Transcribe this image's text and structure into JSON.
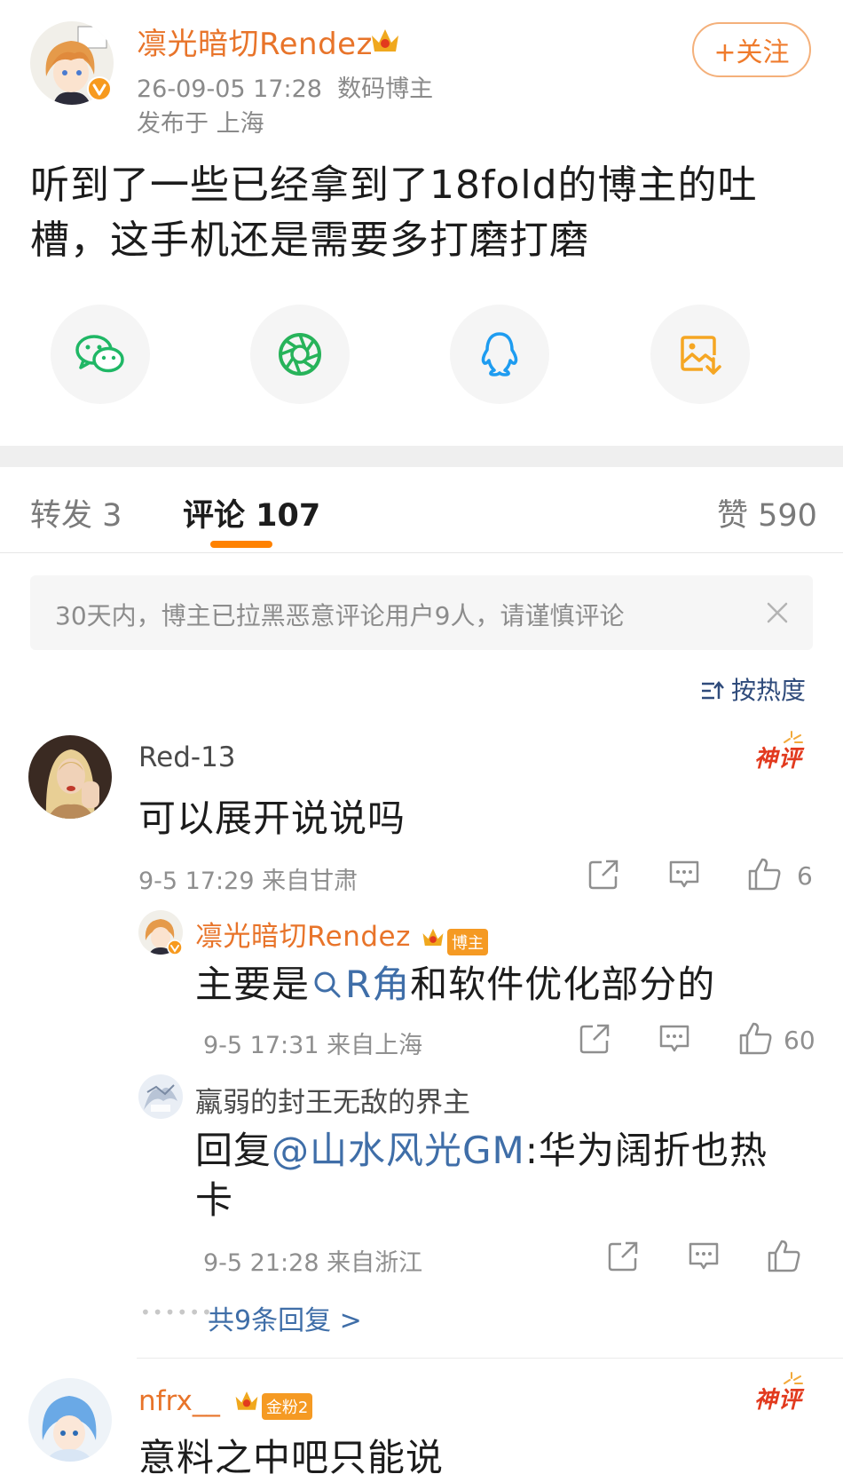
{
  "post": {
    "author": "凛光暗切Rendez",
    "time": "26-09-05 17:28",
    "role": "数码博主",
    "location": "发布于 上海",
    "follow_label": "+关注",
    "text_line1": "听到了一些已经拿到了18fold的博主的吐",
    "text_line2": "槽，这手机还是需要多打磨打磨"
  },
  "share": [
    {
      "icon": "wechat-icon",
      "color": "#1fb765"
    },
    {
      "icon": "moments-icon",
      "color": "#27b35a"
    },
    {
      "icon": "qq-icon",
      "color": "#1e9cf0"
    },
    {
      "icon": "save-image-icon",
      "color": "#f5a623"
    }
  ],
  "tabs": {
    "repost": "转发 3",
    "comments": "评论 107",
    "likes": "赞 590"
  },
  "notice": {
    "text": "30天内，博主已拉黑恶意评论用户9人，请谨慎评论"
  },
  "sort_label": "按热度",
  "comments": [
    {
      "user": "Red-13",
      "badge": "神评",
      "text": "可以展开说说吗",
      "meta": "9-5 17:29 来自甘肃",
      "likes": "6",
      "replies": [
        {
          "user": "凛光暗切Rendez",
          "tag": "博主",
          "text_a": "主要是",
          "text_link": "R角",
          "text_b": "和软件优化部分的",
          "meta": "9-5 17:31 来自上海",
          "likes": "60"
        },
        {
          "user": "羸弱的封王无敌的界主",
          "text_a": "回复",
          "text_link": "@山水风光GM",
          "text_b": ":华为阔折也热",
          "text_c": "卡",
          "meta": "9-5 21:28 来自浙江"
        }
      ],
      "more_replies": "共9条回复 >"
    },
    {
      "user": "nfrx__",
      "tag": "金粉2",
      "badge": "神评",
      "text": "意料之中吧只能说"
    }
  ],
  "colors": {
    "accent": "#ff8200",
    "link": "#3f6ea8",
    "author": "#e8742a"
  }
}
